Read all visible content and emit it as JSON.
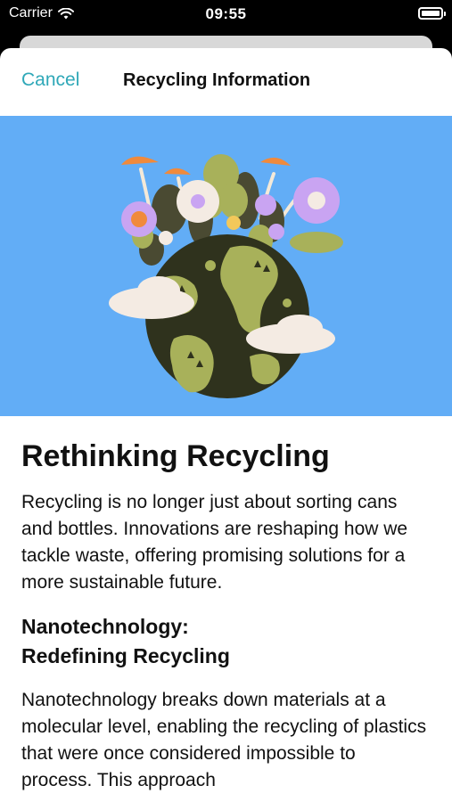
{
  "status_bar": {
    "carrier": "Carrier",
    "time": "09:55"
  },
  "nav": {
    "cancel_label": "Cancel",
    "title": "Recycling Information"
  },
  "hero": {
    "icon": "earth-with-plants-illustration",
    "background_color": "#62adf6"
  },
  "article": {
    "title": "Rethinking Recycling",
    "intro": "Recycling is no longer just about sorting cans and bottles. Innovations are reshaping how we tackle waste, offering promising solutions for a more sustainable future.",
    "section1_heading_line1": "Nanotechnology:",
    "section1_heading_line2": "Redefining Recycling",
    "section1_body": "Nanotechnology breaks down materials at a molecular level, enabling the recycling of plastics that were once considered impossible to process. This approach"
  },
  "colors": {
    "accent": "#2fa8b8"
  }
}
